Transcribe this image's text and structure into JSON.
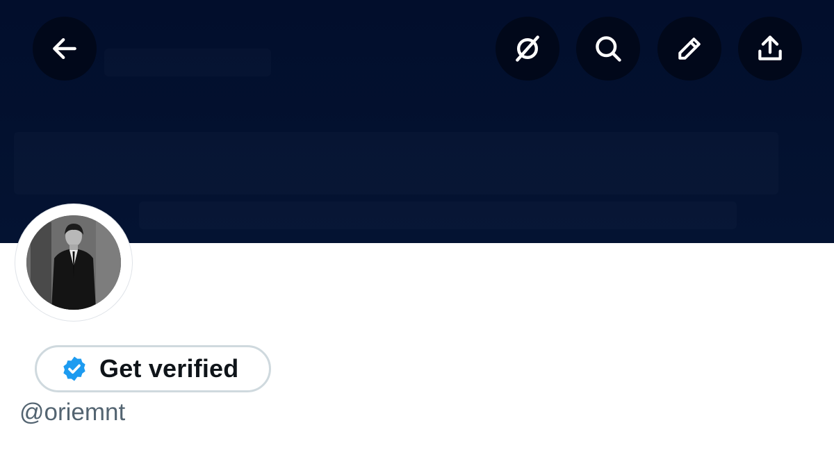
{
  "header": {
    "back_icon": "arrow-left-icon",
    "actions": [
      {
        "icon": "grok-icon"
      },
      {
        "icon": "search-icon"
      },
      {
        "icon": "edit-pencil-icon"
      },
      {
        "icon": "share-icon"
      }
    ],
    "banner_color": "#020e2c"
  },
  "profile": {
    "avatar": "profile-photo",
    "verify_button": {
      "label": "Get verified",
      "badge_color": "#1d9bf0"
    },
    "handle": "@oriemnt"
  }
}
